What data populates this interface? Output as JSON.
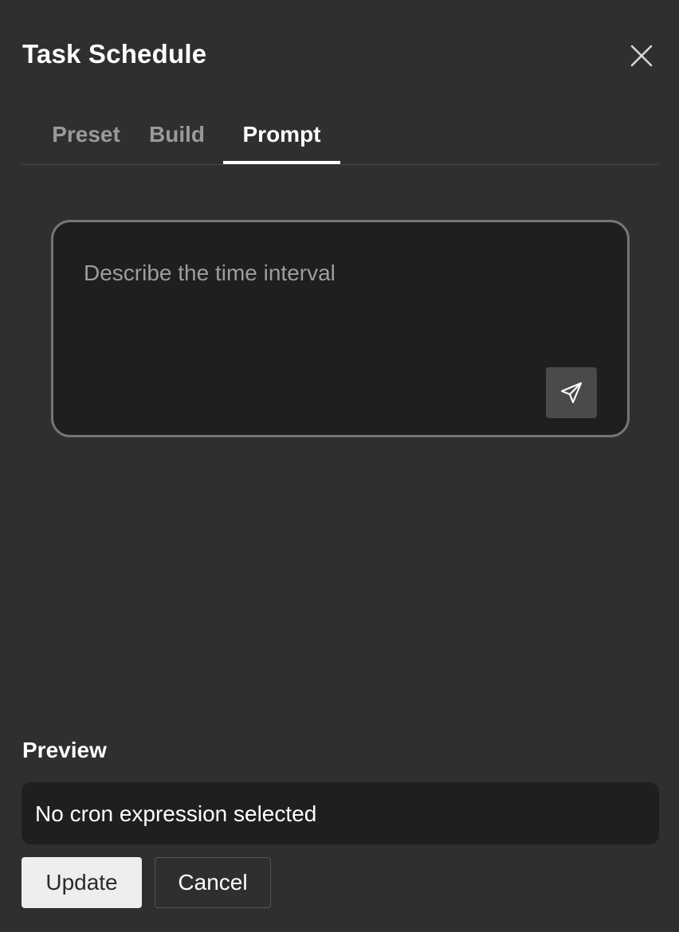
{
  "dialog": {
    "title": "Task Schedule"
  },
  "tabs": [
    {
      "label": "Preset",
      "active": false
    },
    {
      "label": "Build",
      "active": false
    },
    {
      "label": "Prompt",
      "active": true
    }
  ],
  "prompt": {
    "placeholder": "Describe the time interval",
    "value": ""
  },
  "preview": {
    "label": "Preview",
    "text": "No cron expression selected"
  },
  "actions": {
    "update_label": "Update",
    "cancel_label": "Cancel"
  },
  "icons": {
    "close": "close-icon",
    "send": "send-icon"
  },
  "colors": {
    "background": "#2f2f2f",
    "panel": "#1f1f1f",
    "active_tab": "#ffffff",
    "inactive_tab": "#9a9a9a"
  }
}
